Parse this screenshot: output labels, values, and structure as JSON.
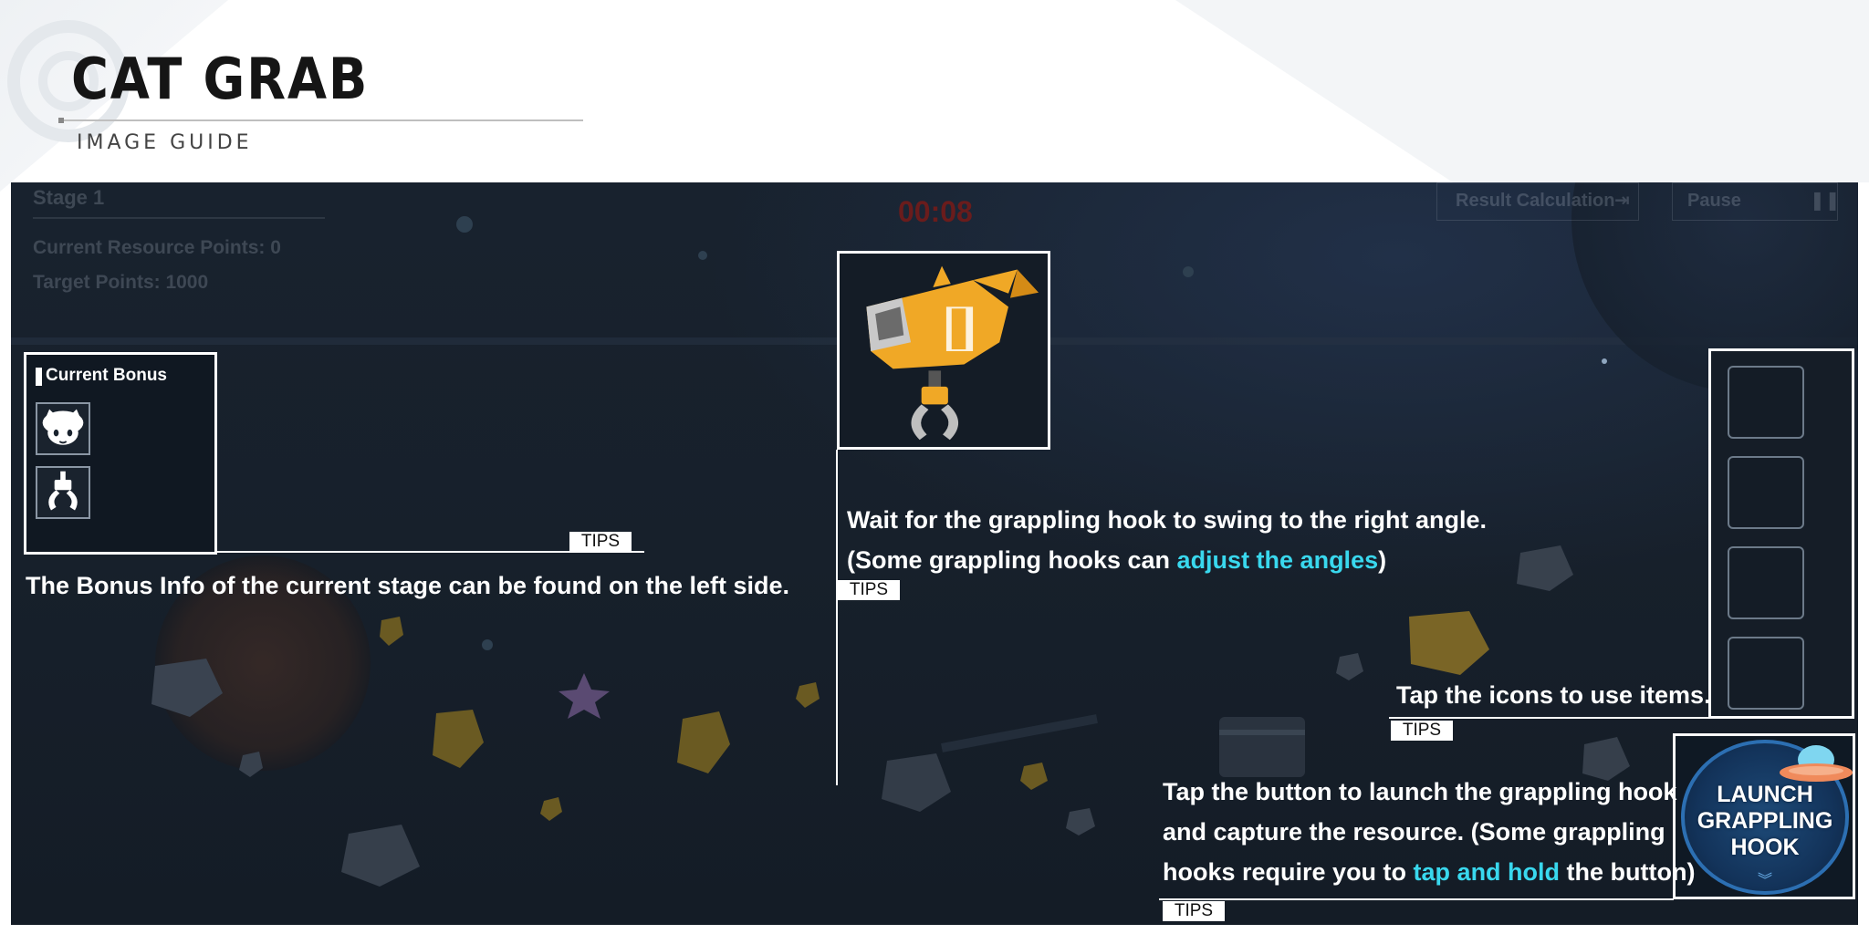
{
  "header": {
    "title": "CAT GRAB",
    "subtitle": "IMAGE GUIDE"
  },
  "hud": {
    "stage": "Stage 1",
    "current_points": "Current Resource Points: 0",
    "target_points": "Target Points: 1000",
    "timer": "00:08",
    "result_button": "Result Calculation",
    "pause_button": "Pause"
  },
  "bonus_panel": {
    "title": "Current Bonus",
    "icons": [
      "cat-face-icon",
      "claw-icon"
    ]
  },
  "tips_label": "TIPS",
  "tip_bonus": "The Bonus Info of the current stage can be found on the left side.",
  "tip_hook": {
    "line1": "Wait for the grappling hook to swing to the right angle.",
    "line2_before": "(Some grappling hooks can ",
    "line2_highlight": "adjust the angles",
    "line2_after": ")"
  },
  "tip_items": "Tap the icons to use items.",
  "tip_launch": {
    "line1": "Tap the button to launch the grappling hook",
    "line2": "and capture the resource. (Some grappling",
    "line3_before": "hooks require you to ",
    "line3_highlight": "tap and hold",
    "line3_after": " the button)"
  },
  "launch_button": {
    "line1": "LAUNCH",
    "line2": "GRAPPLING",
    "line3": "HOOK"
  },
  "colors": {
    "highlight": "#39d8ee",
    "timer": "#7a1e1e",
    "hook_ship": "#f0a826",
    "background": "#17202b"
  }
}
